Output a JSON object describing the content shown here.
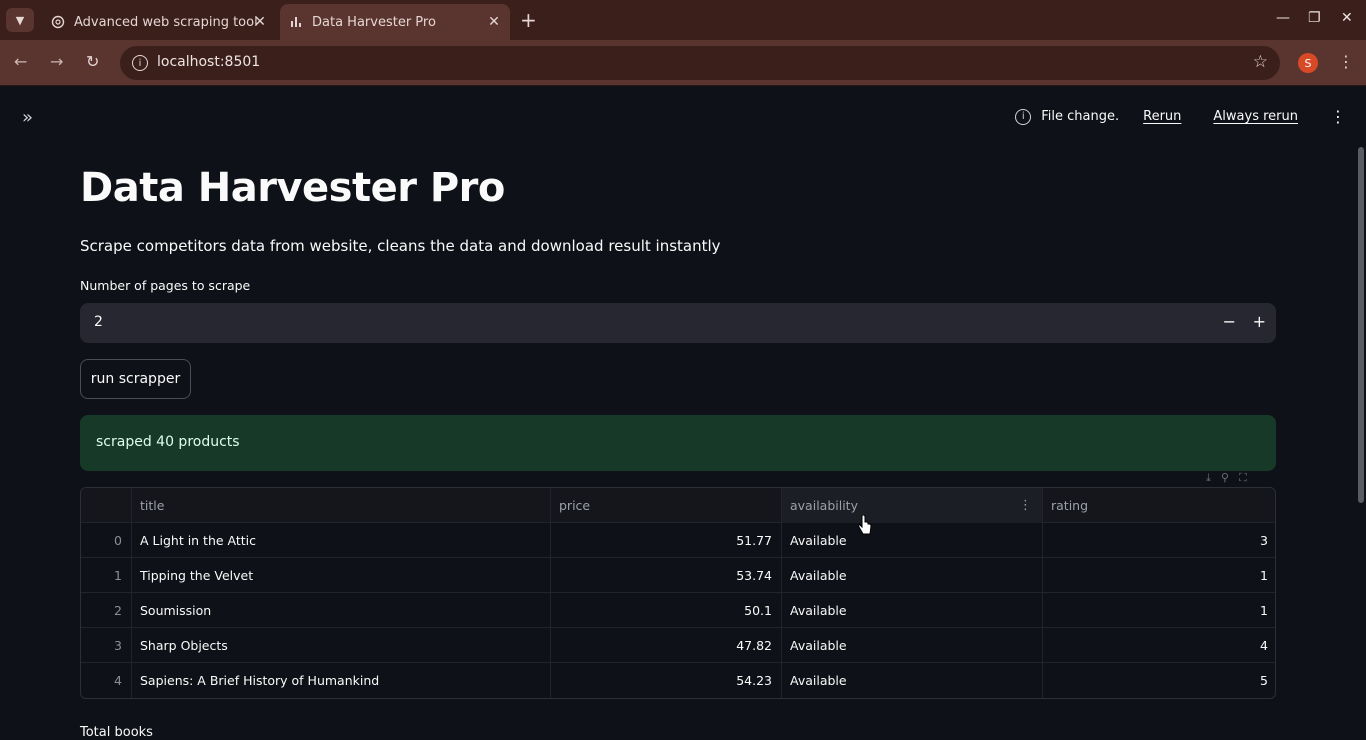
{
  "browser": {
    "tabs": [
      {
        "label": "Advanced web scraping tool",
        "icon": "openai-icon",
        "active": false
      },
      {
        "label": "Data Harvester Pro",
        "icon": "chart-icon",
        "active": true
      }
    ],
    "url": "localhost:8501",
    "profile_initial": "S"
  },
  "status_bar": {
    "message": "File change.",
    "rerun": "Rerun",
    "always_rerun": "Always rerun"
  },
  "main": {
    "title": "Data Harvester Pro",
    "subtitle": "Scrape competitors data from website, cleans the data and download result instantly",
    "pages_label": "Number of pages to scrape",
    "pages_value": "2",
    "run_button": "run scrapper",
    "success_message": "scraped 40 products",
    "total_label": "Total books"
  },
  "table": {
    "columns": [
      "",
      "title",
      "price",
      "availability",
      "rating"
    ],
    "rows": [
      [
        "0",
        "A Light in the Attic",
        "51.77",
        "Available",
        "3"
      ],
      [
        "1",
        "Tipping the Velvet",
        "53.74",
        "Available",
        "1"
      ],
      [
        "2",
        "Soumission",
        "50.1",
        "Available",
        "1"
      ],
      [
        "3",
        "Sharp Objects",
        "47.82",
        "Available",
        "4"
      ],
      [
        "4",
        "Sapiens: A Brief History of Humankind",
        "54.23",
        "Available",
        "5"
      ]
    ]
  },
  "colors": {
    "app_bg": "#0e1117",
    "success_bg": "#173928",
    "browser_frame": "#5a3530",
    "input_bg": "#262730"
  }
}
